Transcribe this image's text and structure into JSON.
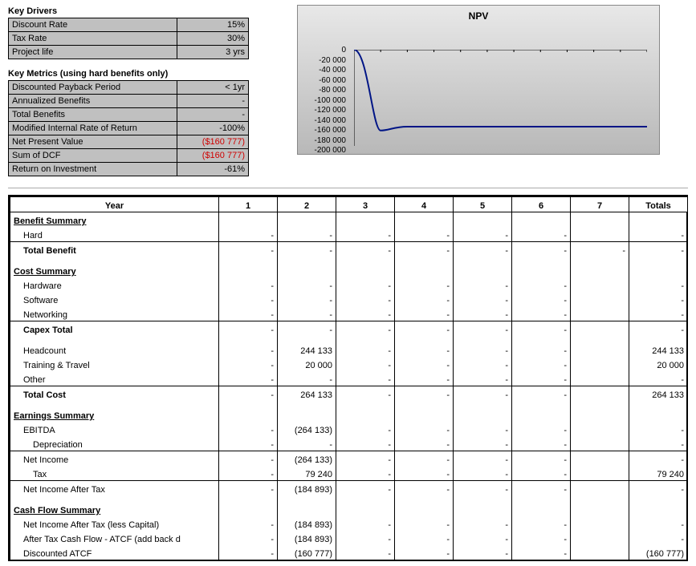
{
  "drivers": {
    "heading": "Key Drivers",
    "rows": [
      {
        "label": "Discount Rate",
        "value": "15%"
      },
      {
        "label": "Tax Rate",
        "value": "30%"
      },
      {
        "label": "Project life",
        "value": "3 yrs"
      }
    ]
  },
  "metrics": {
    "heading": "Key Metrics (using hard benefits only)",
    "rows": [
      {
        "label": "Discounted Payback Period",
        "value": "< 1yr",
        "neg": false
      },
      {
        "label": "Annualized Benefits",
        "value": "-",
        "neg": false
      },
      {
        "label": "Total Benefits",
        "value": "-",
        "neg": false
      },
      {
        "label": "Modified Internal Rate of Return",
        "value": "-100%",
        "neg": false
      },
      {
        "label": "Net Present Value",
        "value": "($160 777)",
        "neg": true
      },
      {
        "label": "Sum of DCF",
        "value": "($160 777)",
        "neg": true
      },
      {
        "label": "Return on Investment",
        "value": "-61%",
        "neg": false
      }
    ]
  },
  "chart_data": {
    "type": "line",
    "title": "NPV",
    "xlabel": "",
    "ylabel": "",
    "ylim": [
      -200000,
      0
    ],
    "yticks": [
      0,
      -20000,
      -40000,
      -60000,
      -80000,
      -100000,
      -120000,
      -140000,
      -160000,
      -180000,
      -200000
    ],
    "ytick_labels": [
      "0",
      "-20 000",
      "-40 000",
      "-60 000",
      "-80 000",
      "-100 000",
      "-120 000",
      "-140 000",
      "-160 000",
      "-180 000",
      "-200 000"
    ],
    "x": [
      1,
      2,
      3,
      4,
      5,
      6,
      7,
      8,
      9,
      10,
      11,
      12
    ],
    "values": [
      0,
      -160000,
      -160000,
      -160000,
      -160000,
      -160000,
      -160000,
      -160000,
      -160000,
      -160000,
      -160000,
      -160000
    ]
  },
  "grid": {
    "year_label": "Year",
    "years": [
      "1",
      "2",
      "3",
      "4",
      "5",
      "6",
      "7"
    ],
    "totals_label": "Totals",
    "sections": {
      "benefit": "Benefit Summary",
      "cost": "Cost Summary",
      "earn": "Earnings Summary",
      "cash": "Cash Flow Summary"
    },
    "rows": [
      {
        "sec": "benefit"
      },
      {
        "label": "Hard",
        "cls": "u",
        "c": [
          "-",
          "-",
          "-",
          "-",
          "-",
          "-",
          "",
          "-"
        ]
      },
      {
        "label": "Total Benefit",
        "cls": "tot",
        "c": [
          "-",
          "-",
          "-",
          "-",
          "-",
          "-",
          "-",
          "-"
        ]
      },
      {
        "spacer": true
      },
      {
        "sec": "cost"
      },
      {
        "label": "Hardware",
        "c": [
          "-",
          "-",
          "-",
          "-",
          "-",
          "-",
          "",
          "-"
        ]
      },
      {
        "label": "Software",
        "c": [
          "-",
          "-",
          "-",
          "-",
          "-",
          "-",
          "",
          "-"
        ]
      },
      {
        "label": "Networking",
        "cls": "u",
        "c": [
          "-",
          "-",
          "-",
          "-",
          "-",
          "-",
          "",
          "-"
        ]
      },
      {
        "label": "Capex Total",
        "cls": "tot",
        "c": [
          "-",
          "-",
          "-",
          "-",
          "-",
          "-",
          "",
          "-"
        ]
      },
      {
        "spacer": true
      },
      {
        "label": "Headcount",
        "c": [
          "-",
          "244 133",
          "-",
          "-",
          "-",
          "-",
          "",
          "244 133"
        ]
      },
      {
        "label": "Training & Travel",
        "c": [
          "-",
          "20 000",
          "-",
          "-",
          "-",
          "-",
          "",
          "20 000"
        ]
      },
      {
        "label": "Other",
        "cls": "u",
        "c": [
          "-",
          "-",
          "-",
          "-",
          "-",
          "-",
          "",
          "-"
        ]
      },
      {
        "label": "Total Cost",
        "cls": "tot",
        "c": [
          "-",
          "264 133",
          "-",
          "-",
          "-",
          "-",
          "",
          "264 133"
        ]
      },
      {
        "spacer": true
      },
      {
        "sec": "earn"
      },
      {
        "label": "EBITDA",
        "c": [
          "-",
          "(264 133)",
          "-",
          "-",
          "-",
          "-",
          "",
          "-"
        ]
      },
      {
        "label": "Depreciation",
        "ind": true,
        "cls": "u",
        "c": [
          "-",
          "-",
          "-",
          "-",
          "-",
          "-",
          "",
          "-"
        ]
      },
      {
        "label": "Net Income",
        "c": [
          "-",
          "(264 133)",
          "-",
          "-",
          "-",
          "-",
          "",
          "-"
        ]
      },
      {
        "label": "Tax",
        "ind": true,
        "cls": "u",
        "c": [
          "-",
          "79 240",
          "-",
          "-",
          "-",
          "-",
          "",
          "79 240"
        ]
      },
      {
        "label": "Net Income After Tax",
        "c": [
          "-",
          "(184 893)",
          "-",
          "-",
          "-",
          "-",
          "",
          "-"
        ]
      },
      {
        "spacer": true
      },
      {
        "sec": "cash"
      },
      {
        "label": "Net Income After Tax (less Capital)",
        "c": [
          "-",
          "(184 893)",
          "-",
          "-",
          "-",
          "-",
          "",
          "-"
        ]
      },
      {
        "label": "After Tax Cash Flow - ATCF (add back d",
        "c": [
          "-",
          "(184 893)",
          "-",
          "-",
          "-",
          "-",
          "",
          "-"
        ]
      },
      {
        "label": "Discounted ATCF",
        "c": [
          "-",
          "(160 777)",
          "-",
          "-",
          "-",
          "-",
          "",
          "(160 777)"
        ]
      }
    ]
  }
}
